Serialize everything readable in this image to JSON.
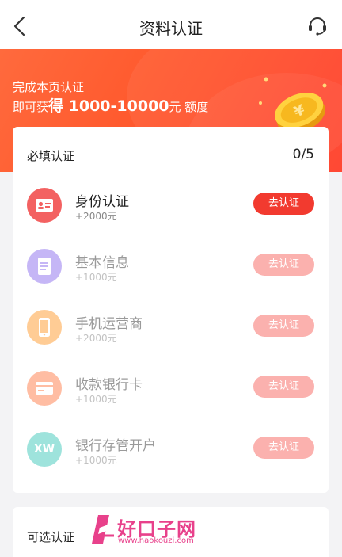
{
  "header": {
    "title": "资料认证",
    "back_icon": "chevron-left-icon",
    "service_icon": "customer-service-icon"
  },
  "banner": {
    "line1": "完成本页认证",
    "line2_prefix": "即可获",
    "line2_strong": "得",
    "line2_amount": " 1000-10000",
    "line2_unit": "元",
    "line2_suffix": " 额度"
  },
  "required": {
    "title": "必填认证",
    "progress": "0/5",
    "items": [
      {
        "label": "身份认证",
        "amount": "+2000元",
        "button": "去认证",
        "icon": "id-card-icon",
        "color": "#f36161",
        "enabled": true
      },
      {
        "label": "基本信息",
        "amount": "+1000元",
        "button": "去认证",
        "icon": "document-icon",
        "color": "#c5b6f6",
        "enabled": false
      },
      {
        "label": "手机运营商",
        "amount": "+2000元",
        "button": "去认证",
        "icon": "mobile-phone-icon",
        "color": "#ffcc95",
        "enabled": false
      },
      {
        "label": "收款银行卡",
        "amount": "+1000元",
        "button": "去认证",
        "icon": "bank-card-icon",
        "color": "#ffbda3",
        "enabled": false
      },
      {
        "label": "银行存管开户",
        "amount": "+1000元",
        "button": "去认证",
        "icon": "xw-bank-icon",
        "icon_text": "XW",
        "color": "#9ee3dc",
        "enabled": false
      }
    ]
  },
  "optional": {
    "title": "可选认证"
  },
  "watermark": {
    "name": "好口子网",
    "url": "www.haokouzi.com"
  }
}
